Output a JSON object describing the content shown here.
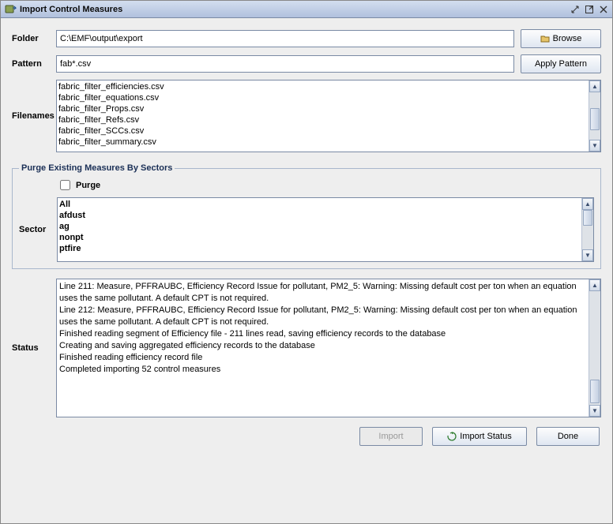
{
  "window": {
    "title": "Import Control Measures"
  },
  "labels": {
    "folder": "Folder",
    "pattern": "Pattern",
    "filenames": "Filenames",
    "sector": "Sector",
    "status": "Status"
  },
  "folder": {
    "value": "C:\\EMF\\output\\export"
  },
  "pattern": {
    "value": "fab*.csv"
  },
  "buttons": {
    "browse": "Browse",
    "apply_pattern": "Apply Pattern",
    "import": "Import",
    "import_status": "Import Status",
    "done": "Done"
  },
  "filenames": [
    "fabric_filter_efficiencies.csv",
    "fabric_filter_equations.csv",
    "fabric_filter_Props.csv",
    "fabric_filter_Refs.csv",
    "fabric_filter_SCCs.csv",
    "fabric_filter_summary.csv"
  ],
  "purge": {
    "legend": "Purge Existing Measures By Sectors",
    "checkbox_label": "Purge",
    "checked": false
  },
  "sectors": [
    "All",
    "afdust",
    "ag",
    "nonpt",
    "ptfire"
  ],
  "status_lines": [
    "Line 211: Measure, PFFRAUBC, Efficiency Record Issue for pollutant, PM2_5: Warning: Missing default cost per ton when an equation uses the same pollutant.  A default CPT is not required.",
    "Line 212: Measure, PFFRAUBC, Efficiency Record Issue for pollutant, PM2_5: Warning: Missing default cost per ton when an equation uses the same pollutant.  A default CPT is not required.",
    "Finished reading segment of Efficiency file - 211 lines read, saving efficiency records to the database",
    "Creating and saving aggregated efficiency records to the database",
    "Finished reading efficiency record file",
    "Completed importing 52 control measures"
  ]
}
